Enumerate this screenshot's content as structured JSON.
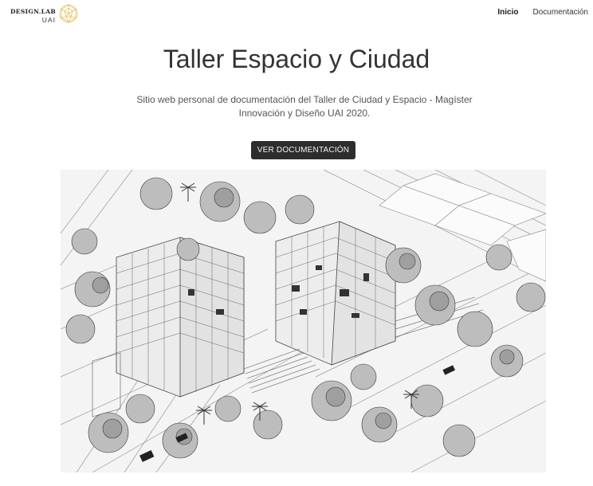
{
  "navbar": {
    "brand": {
      "line1": "DESIGN.LAB",
      "line2": "UAI",
      "logo_icon": "geodesic-sphere-icon",
      "logo_color": "#e3c45a"
    },
    "links": [
      {
        "label": "Inicio",
        "active": true
      },
      {
        "label": "Documentación",
        "active": false
      }
    ]
  },
  "hero": {
    "title": "Taller Espacio y Ciudad",
    "subtitle": "Sitio web personal de documentación del Taller de Ciudad y Espacio - Magíster Innovación y Diseño UAI 2020.",
    "button_label": "VER DOCUMENTACIÓN",
    "button_color": "#2d2d2d"
  },
  "image": {
    "subject": "architectural-axonometric-drawing"
  }
}
